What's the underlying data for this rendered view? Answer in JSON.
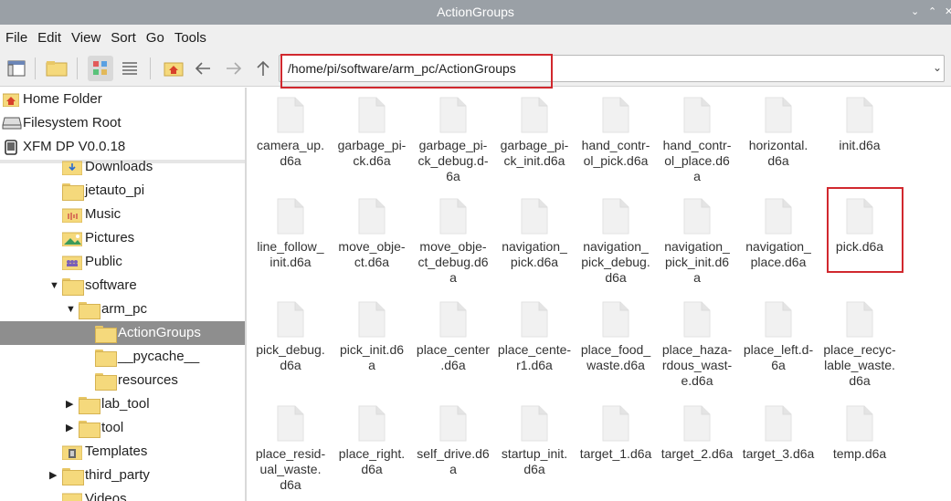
{
  "window": {
    "title": "ActionGroups",
    "controls": [
      "⌄",
      "⌃",
      "✕"
    ]
  },
  "menu": [
    "File",
    "Edit",
    "View",
    "Sort",
    "Go",
    "Tools"
  ],
  "path": {
    "value": "/home/pi/software/arm_pc/ActionGroups"
  },
  "places": [
    {
      "label": "Home Folder",
      "icon": "home-icon"
    },
    {
      "label": "Filesystem Root",
      "icon": "drive-icon"
    },
    {
      "label": "XFM DP V0.0.18",
      "icon": "device-icon"
    }
  ],
  "tree": [
    {
      "label": "Downloads",
      "depth": 1,
      "arrow": "",
      "icon": "downloads-icon"
    },
    {
      "label": "jetauto_pi",
      "depth": 1,
      "arrow": "",
      "icon": "folder-icon"
    },
    {
      "label": "Music",
      "depth": 1,
      "arrow": "",
      "icon": "music-icon"
    },
    {
      "label": "Pictures",
      "depth": 1,
      "arrow": "",
      "icon": "pictures-icon"
    },
    {
      "label": "Public",
      "depth": 1,
      "arrow": "",
      "icon": "public-icon"
    },
    {
      "label": "software",
      "depth": 1,
      "arrow": "▼",
      "icon": "folder-icon"
    },
    {
      "label": "arm_pc",
      "depth": 2,
      "arrow": "▼",
      "icon": "folder-icon"
    },
    {
      "label": "ActionGroups",
      "depth": 3,
      "arrow": "",
      "icon": "folder-icon",
      "selected": true
    },
    {
      "label": "__pycache__",
      "depth": 3,
      "arrow": "",
      "icon": "folder-icon"
    },
    {
      "label": "resources",
      "depth": 3,
      "arrow": "",
      "icon": "folder-icon"
    },
    {
      "label": "lab_tool",
      "depth": 2,
      "arrow": "▶",
      "icon": "folder-icon"
    },
    {
      "label": "tool",
      "depth": 2,
      "arrow": "▶",
      "icon": "folder-icon"
    },
    {
      "label": "Templates",
      "depth": 1,
      "arrow": "",
      "icon": "templates-icon"
    },
    {
      "label": "third_party",
      "depth": 1,
      "arrow": "▶",
      "icon": "folder-icon"
    },
    {
      "label": "Videos",
      "depth": 1,
      "arrow": "",
      "icon": "videos-icon"
    }
  ],
  "files": [
    "camera_up.\nd6a",
    "garbage_pi-\nck.d6a",
    "garbage_pi-\nck_debug.d-\n6a",
    "garbage_pi-\nck_init.d6a",
    "hand_contr-\nol_pick.d6a",
    "hand_contr-\nol_place.d6\na",
    "horizontal.\nd6a",
    "init.d6a",
    "line_follow_\ninit.d6a",
    "move_obje-\nct.d6a",
    "move_obje-\nct_debug.d6\na",
    "navigation_\npick.d6a",
    "navigation_\npick_debug.\nd6a",
    "navigation_\npick_init.d6\na",
    "navigation_\nplace.d6a",
    "pick.d6a",
    "pick_debug.\nd6a",
    "pick_init.d6\na",
    "place_center\n.d6a",
    "place_cente-\nr1.d6a",
    "place_food_\nwaste.d6a",
    "place_haza-\nrdous_wast-\ne.d6a",
    "place_left.d-\n6a",
    "place_recyc-\nlable_waste.\nd6a",
    "place_resid-\nual_waste.\nd6a",
    "place_right.\nd6a",
    "self_drive.d6\na",
    "startup_init.\nd6a",
    "target_1.d6a",
    "target_2.d6a",
    "target_3.d6a",
    "temp.d6a"
  ]
}
